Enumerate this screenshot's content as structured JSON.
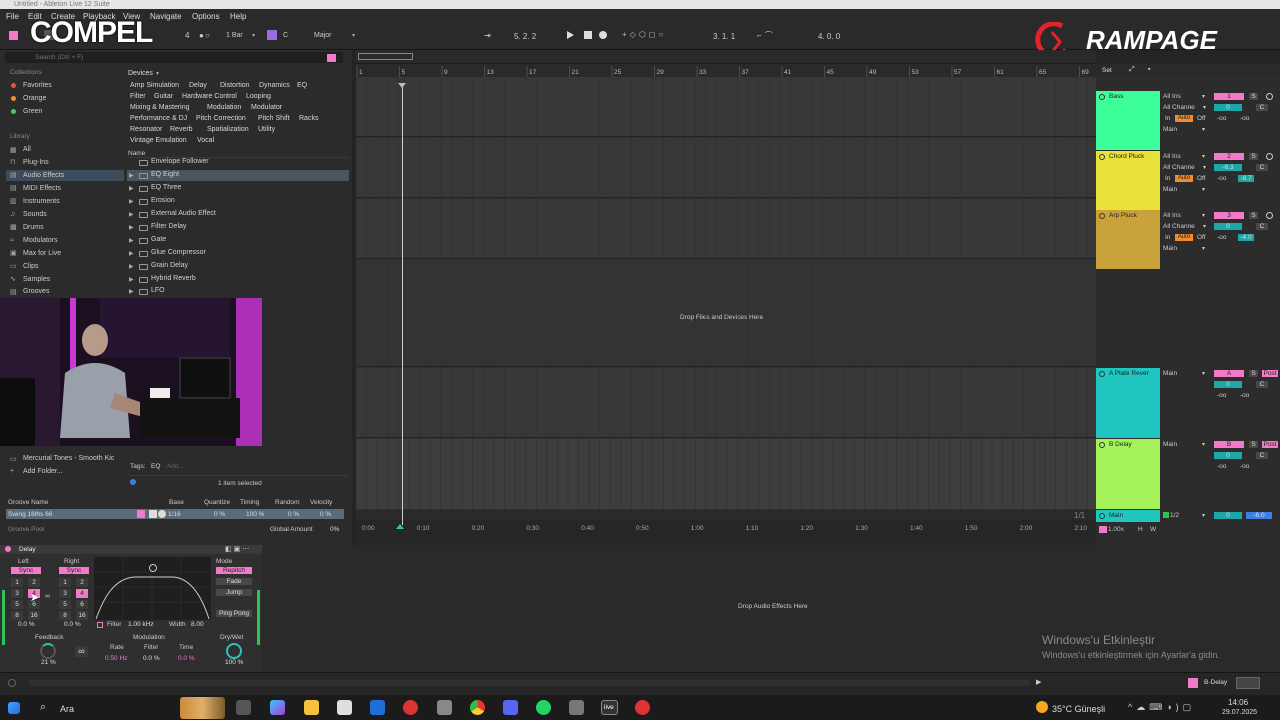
{
  "window": {
    "title": "Untitled - Ableton Live 12 Suite"
  },
  "menu": [
    "File",
    "Edit",
    "Create",
    "Playback",
    "View",
    "Navigate",
    "Options",
    "Help"
  ],
  "overlays": {
    "left_logo": "COMPEL",
    "right_logo": "RAMPAGE"
  },
  "control_bar": {
    "quantize": "1 Bar",
    "key": "C",
    "scale": "Major",
    "position": "5.  2.  2",
    "loop_start": "3.  1.  1",
    "loop_length": "4.  0.  0",
    "ext_num": "4"
  },
  "browser": {
    "search_placeholder": "Search (Ctrl + F)",
    "collections_header": "Collections",
    "collections": [
      {
        "label": "Favorites",
        "color": "#e8533b"
      },
      {
        "label": "Orange",
        "color": "#f0902a"
      },
      {
        "label": "Green",
        "color": "#3fcf5a"
      }
    ],
    "library_header": "Library",
    "library": [
      "All",
      "Plug-Ins",
      "Audio Effects",
      "MIDI Effects",
      "Instruments",
      "Sounds",
      "Drums",
      "Modulators",
      "Max for Live",
      "Clips",
      "Samples",
      "Grooves"
    ],
    "library_selected": "Audio Effects",
    "places": [
      "Mercurial Tones - Smooth Kic",
      "Add Folder..."
    ],
    "devices_header": "Devices",
    "device_rows": [
      [
        "Amp Simulation",
        "Delay",
        "Distortion",
        "Dynamics",
        "EQ"
      ],
      [
        "Filter",
        "Guitar",
        "Hardware Control",
        "Looping"
      ],
      [
        "Mixing & Mastering",
        "Modulation",
        "Modulator"
      ],
      [
        "Performance & DJ",
        "Pitch Correction",
        "Pitch Shift",
        "Racks"
      ],
      [
        "Resonator",
        "Reverb",
        "Spatialization",
        "Utility"
      ],
      [
        "Vintage Emulation",
        "Vocal"
      ]
    ],
    "name_header": "Name",
    "files": [
      "Envelope Follower",
      "EQ Eight",
      "EQ Three",
      "Erosion",
      "External Audio Effect",
      "Filter Delay",
      "Gate",
      "Glue Compressor",
      "Grain Delay",
      "Hybrid Reverb",
      "LFO"
    ],
    "file_selected": "EQ Eight",
    "tags_label": "Tags:",
    "tags_value": "EQ",
    "tags_add": "Add...",
    "status": "1 item selected"
  },
  "groove": {
    "headers": [
      "Groove Name",
      "Base",
      "Quantize",
      "Timing",
      "Random",
      "Velocity"
    ],
    "row": {
      "name": "Swing 16ths 66",
      "base": "1/16",
      "quantize": "0 %",
      "timing": "100 %",
      "random": "0 %",
      "velocity": "0 %"
    },
    "pool_label": "Groove Pool",
    "global_label": "Global Amount",
    "global_value": "0%"
  },
  "arrangement": {
    "bars": [
      "1",
      "5",
      "9",
      "13",
      "17",
      "21",
      "25",
      "29",
      "33",
      "37",
      "41",
      "45",
      "49",
      "53",
      "57",
      "61",
      "65",
      "69"
    ],
    "times": [
      "0:00",
      "0:10",
      "0:20",
      "0:30",
      "0:40",
      "0:50",
      "1:00",
      "1:10",
      "1:20",
      "1:30",
      "1:40",
      "1:50",
      "2:00",
      "2:10"
    ],
    "drop_text": "Drop Files and Devices Here",
    "zoom": "1/1",
    "set_label": "Set"
  },
  "tracks": [
    {
      "name": "Bass",
      "color": "#3dff99",
      "input": "All Ins",
      "channel": "All Channe",
      "num": "1",
      "vol": "0",
      "pan": "C",
      "out": "Main"
    },
    {
      "name": "Chord Pluck",
      "color": "#e8e13a",
      "input": "All Ins",
      "channel": "All Channe",
      "num": "2",
      "vol": "-6.3",
      "pan": "C",
      "out": "Main",
      "extra": "-8.7"
    },
    {
      "name": "Arp Pluck",
      "color": "#c9a23a",
      "input": "All Ins",
      "channel": "All Channe",
      "num": "3",
      "vol": "0",
      "pan": "C",
      "out": "Main",
      "extra": "-4.0"
    },
    {
      "name": "A Plate Rever",
      "color": "#1fc7c0",
      "num": "A",
      "vol": "0",
      "pan": "C",
      "out": "Main"
    },
    {
      "name": "B Delay",
      "color": "#a6f25a",
      "num": "B",
      "vol": "0",
      "pan": "C",
      "out": "Main"
    },
    {
      "name": "Main",
      "color": "#1fc7c0",
      "num": "1/2",
      "vol": "0",
      "extra": "-6.0"
    }
  ],
  "track_labels": {
    "in": "In",
    "auto": "Auto",
    "off": "Off",
    "s": "S",
    "post": "Post",
    "inf": "-oo",
    "cue": "1.00x",
    "h": "H",
    "w": "W"
  },
  "delay": {
    "title": "Delay",
    "left_label": "Left",
    "right_label": "Right",
    "sync": "Sync",
    "keys": [
      "1",
      "2",
      "3",
      "4",
      "5",
      "6",
      "8",
      "16"
    ],
    "left_offset": "0.0 %",
    "right_offset": "0.0 %",
    "filter_label": "Filter",
    "filter_freq": "1.00 kHz",
    "width_label": "Width",
    "width_value": "8.00",
    "mode_label": "Mode",
    "modes": [
      "Repitch",
      "Fade",
      "Jump"
    ],
    "mode_selected": "Repitch",
    "ping_pong": "Ping Pong",
    "feedback_label": "Feedback",
    "feedback_value": "21 %",
    "modulation_label": "Modulation",
    "rate_label": "Rate",
    "rate_value": "0.50 Hz",
    "mod_filter_label": "Filter",
    "mod_filter_value": "0.0 %",
    "time_label": "Time",
    "time_value": "0.0 %",
    "drywet_label": "Dry/Wet",
    "drywet_value": "100 %"
  },
  "fx_drop_text": "Drop Audio Effects Here",
  "activation": {
    "title": "Windows'u Etkinleştir",
    "subtitle": "Windows'u etkinleştirmek için Ayarlar'a gidin."
  },
  "status_right": "B-Delay",
  "taskbar": {
    "search": "Ara",
    "weather": "35°C  Güneşli",
    "time": "14:06",
    "date": "29.07.2025",
    "live": "live"
  }
}
